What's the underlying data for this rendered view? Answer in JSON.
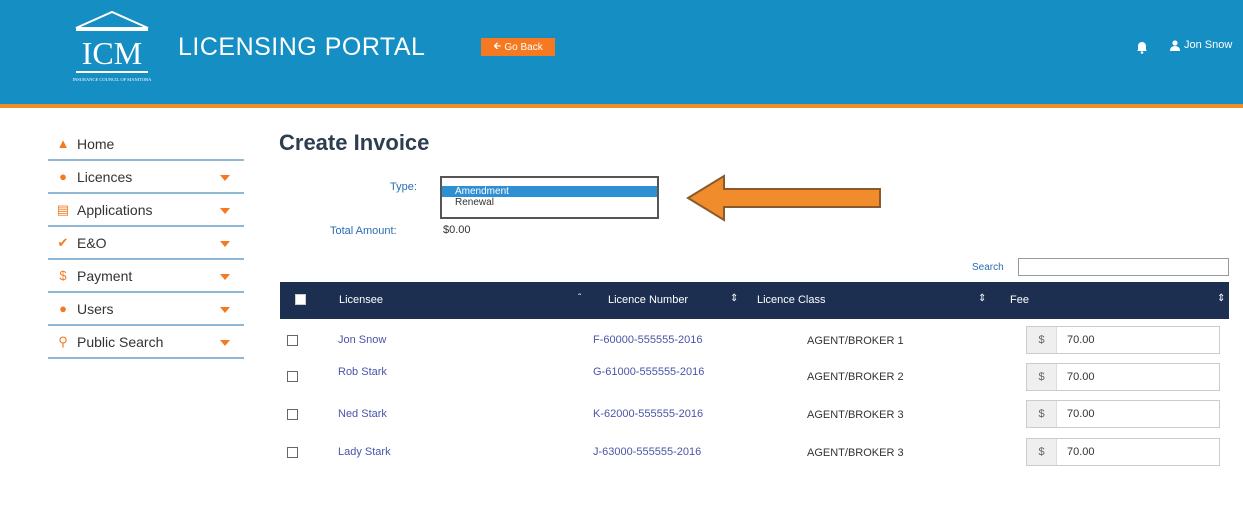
{
  "header": {
    "logo_text": "ICM",
    "logo_subtext": "INSURANCE COUNCIL OF MANITOBA",
    "title": "LICENSING PORTAL",
    "go_back_label": "Go Back",
    "user_name": "Jon Snow"
  },
  "sidebar": {
    "items": [
      {
        "label": "Home",
        "icon": "home-icon",
        "has_caret": false
      },
      {
        "label": "Licences",
        "icon": "circle-icon",
        "has_caret": true
      },
      {
        "label": "Applications",
        "icon": "calendar-icon",
        "has_caret": true
      },
      {
        "label": "E&O",
        "icon": "checkmark-icon",
        "has_caret": true
      },
      {
        "label": "Payment",
        "icon": "dollar-icon",
        "has_caret": true
      },
      {
        "label": "Users",
        "icon": "users-icon",
        "has_caret": true
      },
      {
        "label": "Public Search",
        "icon": "search-icon",
        "has_caret": true
      }
    ]
  },
  "main": {
    "title": "Create Invoice",
    "type_label": "Type:",
    "type_options": [
      "Amendment",
      "Renewal"
    ],
    "type_selected": "Amendment",
    "total_label": "Total Amount:",
    "total_value": "$0.00",
    "search_label": "Search"
  },
  "table": {
    "columns": [
      "Licensee",
      "Licence Number",
      "Licence Class",
      "Fee"
    ],
    "rows": [
      {
        "licensee": "Jon Snow",
        "licence_number": "F-60000-555555-2016",
        "licence_class": "AGENT/BROKER 1",
        "currency": "$",
        "fee": "70.00"
      },
      {
        "licensee": "Rob Stark",
        "licence_number": "G-61000-555555-2016",
        "licence_class": "AGENT/BROKER 2",
        "currency": "$",
        "fee": "70.00"
      },
      {
        "licensee": "Ned Stark",
        "licence_number": "K-62000-555555-2016",
        "licence_class": "AGENT/BROKER 3",
        "currency": "$",
        "fee": "70.00"
      },
      {
        "licensee": "Lady Stark",
        "licence_number": "J-63000-555555-2016",
        "licence_class": "AGENT/BROKER 3",
        "currency": "$",
        "fee": "70.00"
      }
    ]
  },
  "colors": {
    "header_bg": "#148ec3",
    "accent": "#f47920",
    "table_header_bg": "#1c2f50",
    "link": "#4a55a8",
    "selected_option": "#2e8fd3"
  }
}
